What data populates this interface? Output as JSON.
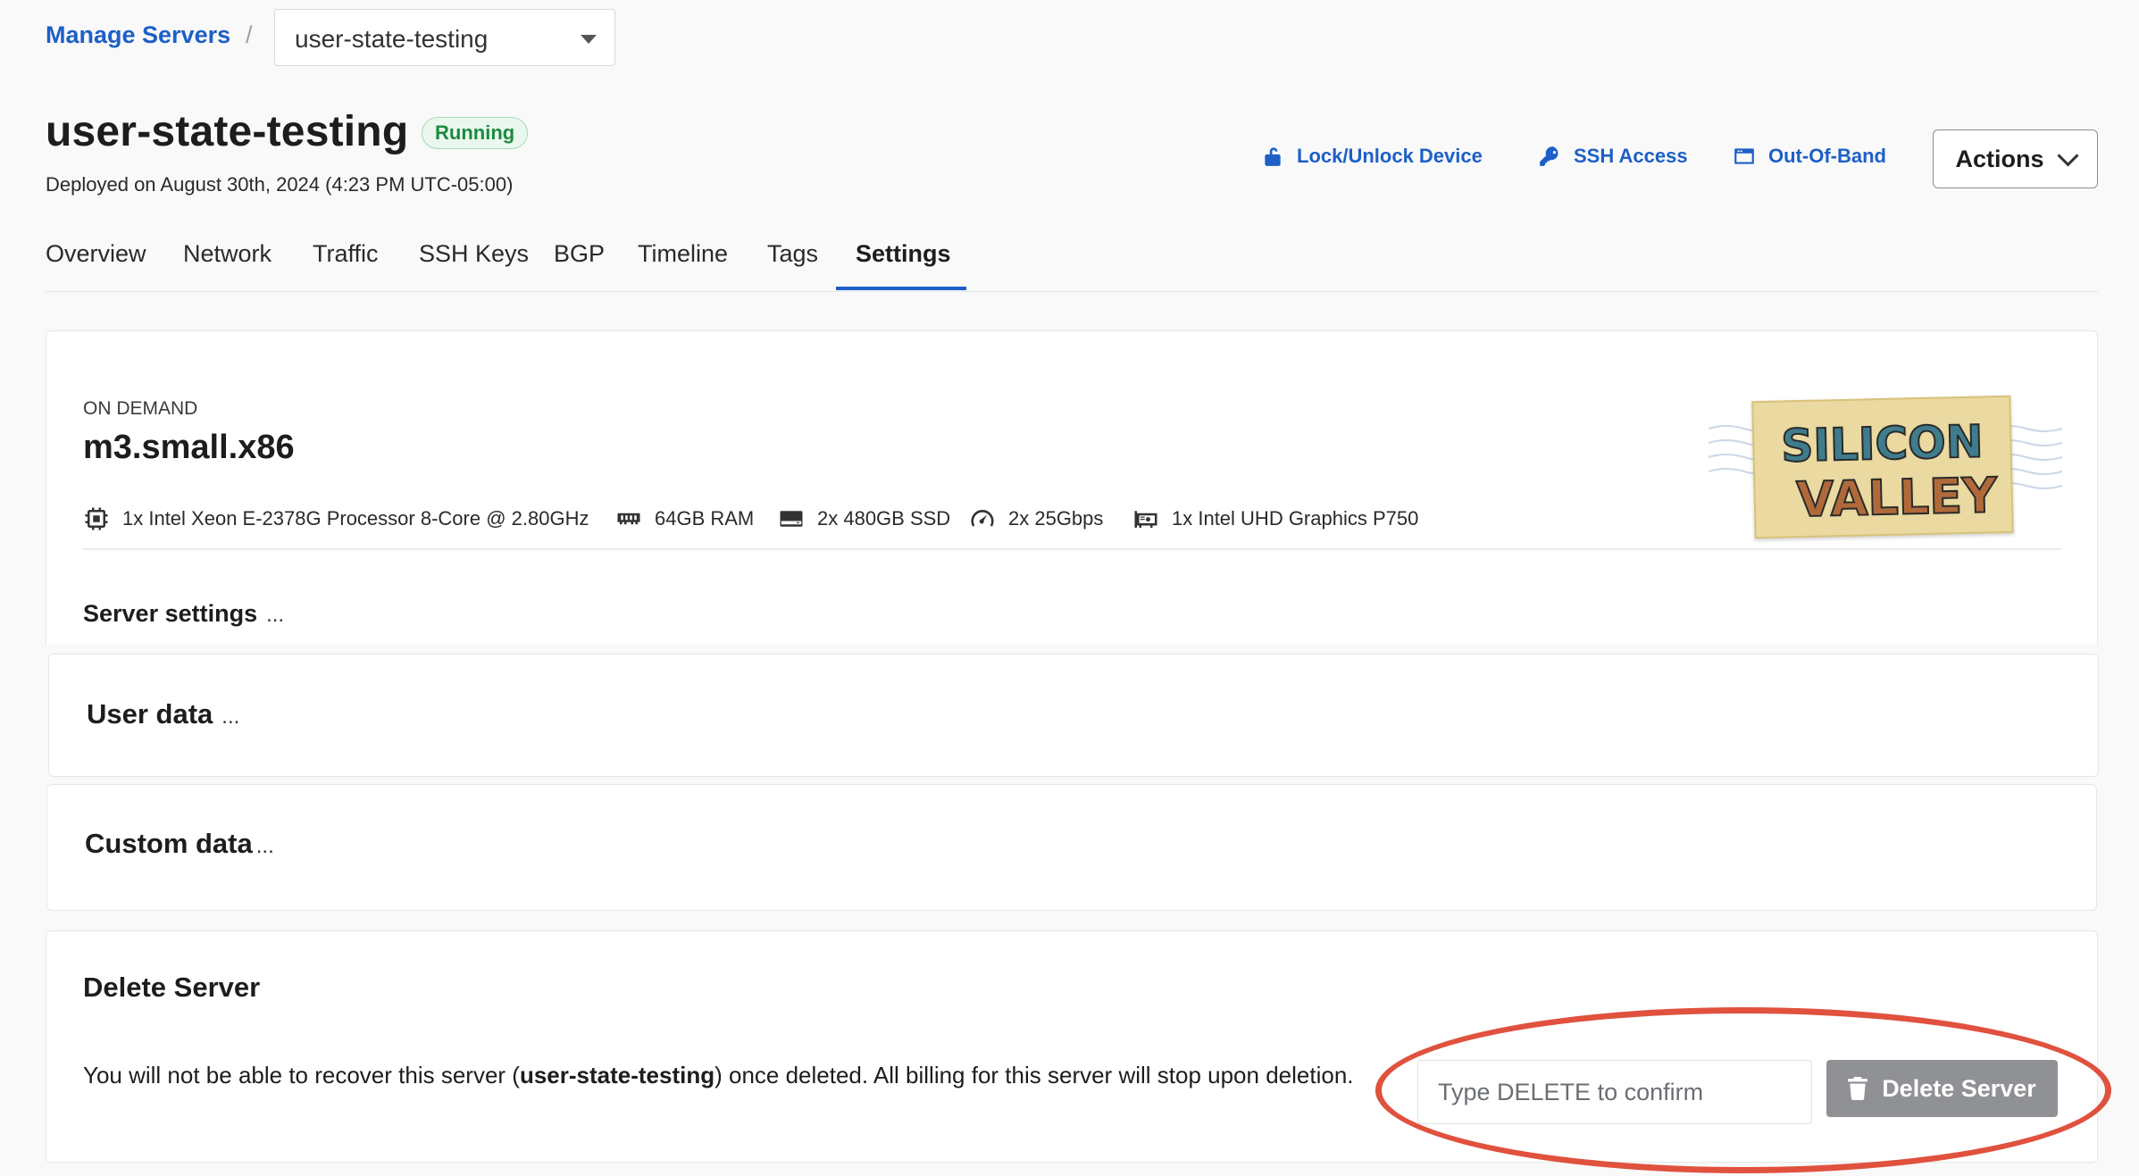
{
  "breadcrumb": {
    "link": "Manage Servers",
    "separator": "/",
    "selected_server": "user-state-testing"
  },
  "header": {
    "title": "user-state-testing",
    "status": "Running",
    "deployed": "Deployed on August 30th, 2024 (4:23 PM UTC-05:00)",
    "links": {
      "lock": "Lock/Unlock Device",
      "ssh": "SSH Access",
      "oob": "Out-Of-Band"
    },
    "actions": "Actions"
  },
  "tabs": [
    "Overview",
    "Network",
    "Traffic",
    "SSH Keys",
    "BGP",
    "Timeline",
    "Tags",
    "Settings"
  ],
  "active_tab": "Settings",
  "plan": {
    "type": "ON DEMAND",
    "name": "m3.small.x86",
    "specs": {
      "cpu": "1x Intel Xeon E-2378G Processor 8-Core @ 2.80GHz",
      "ram": "64GB RAM",
      "storage": "2x 480GB SSD",
      "network": "2x 25Gbps",
      "gpu": "1x Intel UHD Graphics P750"
    },
    "location_art": {
      "line1": "SILICON",
      "line2": "VALLEY"
    }
  },
  "sections": {
    "server_settings": "Server settings",
    "user_data": "User data",
    "custom_data": "Custom data",
    "ellipsis": "..."
  },
  "delete": {
    "title": "Delete Server",
    "desc_before": "You will not be able to recover this server (",
    "desc_server": "user-state-testing",
    "desc_after": ") once deleted. All billing for this server will stop upon deletion.",
    "placeholder": "Type DELETE to confirm",
    "button": "Delete Server"
  },
  "colors": {
    "link": "#1d5fc7",
    "status_green": "#1c8a3f",
    "highlight": "#e0513e",
    "delete_button": "#8f9195"
  }
}
